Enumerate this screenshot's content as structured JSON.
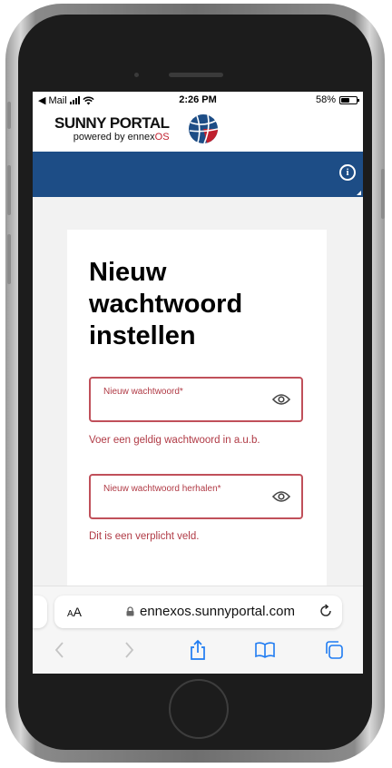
{
  "status_bar": {
    "back_app": "◀ Mail",
    "time": "2:26 PM",
    "battery_text": "58%",
    "battery_level": 0.58
  },
  "header": {
    "logo_title": "SUNNY PORTAL",
    "logo_sub_prefix": "powered by ennex",
    "logo_sub_brand": "OS"
  },
  "form": {
    "title": "Nieuw wachtwoord instellen",
    "new_password": {
      "label": "Nieuw wachtwoord*",
      "value": "",
      "error": "Voer een geldig wachtwoord in a.u.b."
    },
    "repeat_password": {
      "label": "Nieuw wachtwoord herhalen*",
      "value": "",
      "error": "Dit is een verplicht veld."
    }
  },
  "safari": {
    "aa_label_small": "A",
    "aa_label_big": "A",
    "url": "ennexos.sunnyportal.com"
  },
  "colors": {
    "nav_blue": "#1d4d86",
    "error_red": "#b03a45",
    "brand_red": "#c0202e"
  }
}
